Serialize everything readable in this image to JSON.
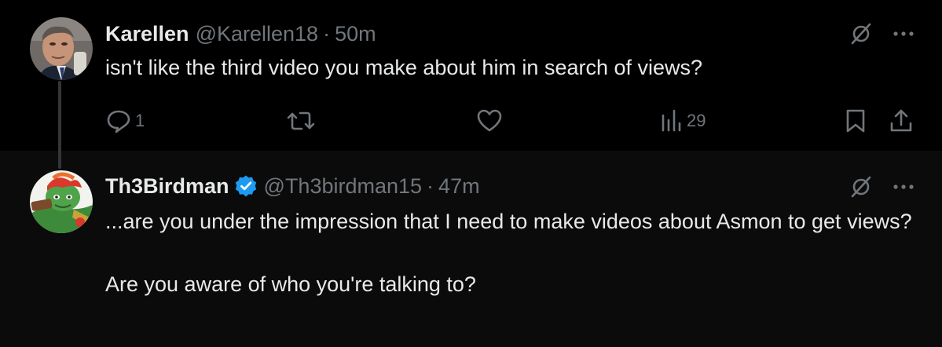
{
  "tweets": [
    {
      "display_name": "Karellen",
      "handle": "@Karellen18",
      "separator": "·",
      "time": "50m",
      "text": "isn't like the third video you make about him in search of views?",
      "avatar_icon": "user-photo-avatar",
      "actions": {
        "replies": "1",
        "views": "29"
      }
    },
    {
      "display_name": "Th3Birdman",
      "verified": true,
      "handle": "@Th3birdman15",
      "separator": "·",
      "time": "47m",
      "text": "...are you under the impression that I need to make videos about Asmon to get views?\n\nAre you aware of who you're talking to?",
      "avatar_icon": "cartoon-character-avatar"
    }
  ],
  "colors": {
    "background": "#000000",
    "reply_background": "#0b0b0b",
    "text": "#e7e9ea",
    "secondary_text": "#71767b",
    "verified": "#1d9bf0",
    "thread_line": "#333639"
  }
}
